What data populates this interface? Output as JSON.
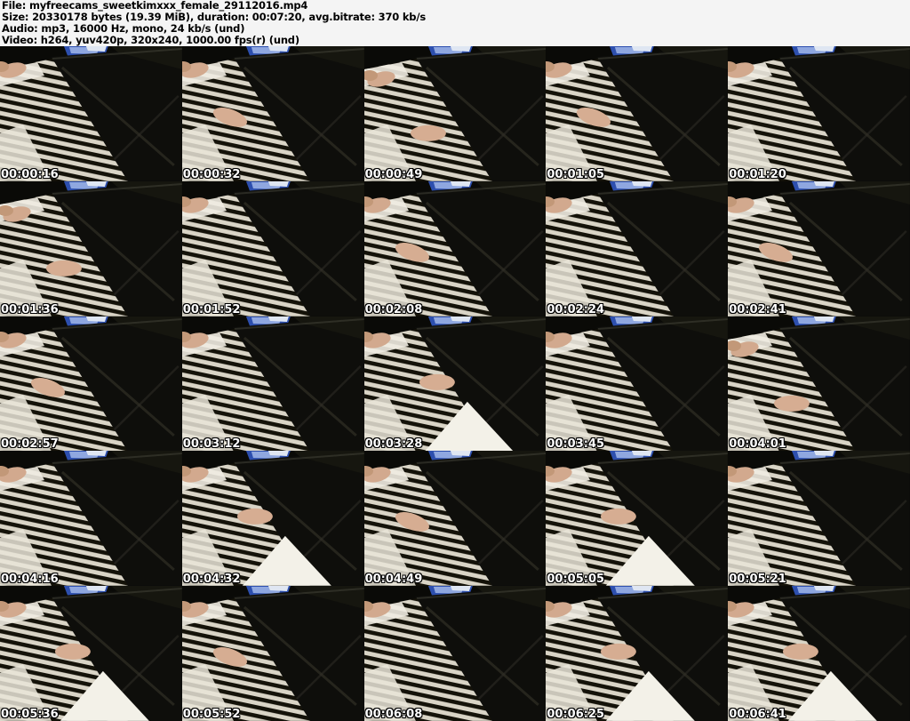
{
  "header": {
    "file_line": "File: myfreecams_sweetkimxxx_female_29112016.mp4",
    "size_line": "Size: 20330178 bytes (19.39 MiB), duration: 00:07:20, avg.bitrate: 370 kb/s",
    "audio_line": "Audio: mp3, 16000 Hz, mono, 24 kb/s (und)",
    "video_line": "Video: h264, yuv420p, 320x240, 1000.00 fps(r) (und)"
  },
  "grid": {
    "rows": 5,
    "cols": 5
  },
  "thumbnails": [
    {
      "timestamp": "00:00:16"
    },
    {
      "timestamp": "00:00:32"
    },
    {
      "timestamp": "00:00:49"
    },
    {
      "timestamp": "00:01:05"
    },
    {
      "timestamp": "00:01:20"
    },
    {
      "timestamp": "00:01:36"
    },
    {
      "timestamp": "00:01:52"
    },
    {
      "timestamp": "00:02:08"
    },
    {
      "timestamp": "00:02:24"
    },
    {
      "timestamp": "00:02:41"
    },
    {
      "timestamp": "00:02:57"
    },
    {
      "timestamp": "00:03:12"
    },
    {
      "timestamp": "00:03:28"
    },
    {
      "timestamp": "00:03:45"
    },
    {
      "timestamp": "00:04:01"
    },
    {
      "timestamp": "00:04:16"
    },
    {
      "timestamp": "00:04:32"
    },
    {
      "timestamp": "00:04:49"
    },
    {
      "timestamp": "00:05:05"
    },
    {
      "timestamp": "00:05:21"
    },
    {
      "timestamp": "00:05:36"
    },
    {
      "timestamp": "00:05:52"
    },
    {
      "timestamp": "00:06:08"
    },
    {
      "timestamp": "00:06:25"
    },
    {
      "timestamp": "00:06:41"
    }
  ],
  "colors": {
    "header_bg": "#f4f4f4",
    "header_text": "#000000",
    "timestamp_text": "#ffffff",
    "timestamp_outline": "#000000",
    "piano_body_black": "#0e0e0b",
    "white_keys": "#d9d4c6",
    "black_keys": "#141209",
    "book_blue": "#2d4fae",
    "skin_tone": "#d2a98e"
  }
}
